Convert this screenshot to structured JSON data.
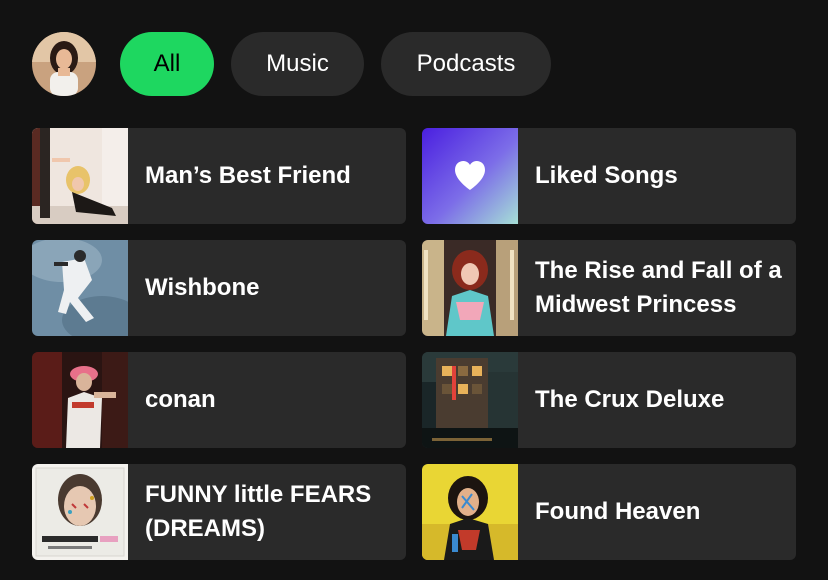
{
  "filters": {
    "all_label": "All",
    "music_label": "Music",
    "podcasts_label": "Podcasts",
    "active": "All"
  },
  "shortcuts": [
    {
      "title": "Man’s Best Friend",
      "cover_icon": "album-cover"
    },
    {
      "title": "Liked Songs",
      "cover_icon": "heart-icon"
    },
    {
      "title": "Wishbone",
      "cover_icon": "album-cover"
    },
    {
      "title": "The Rise and Fall of a Midwest Princess",
      "cover_icon": "album-cover"
    },
    {
      "title": "conan",
      "cover_icon": "album-cover"
    },
    {
      "title": "The Crux Deluxe",
      "cover_icon": "album-cover"
    },
    {
      "title": "FUNNY little FEARS (DREAMS)",
      "cover_icon": "album-cover"
    },
    {
      "title": "Found Heaven",
      "cover_icon": "album-cover"
    }
  ],
  "colors": {
    "background": "#121212",
    "tile": "#2a2a2a",
    "accent": "#1ed760",
    "liked_gradient_start": "#4a1fe0",
    "liked_gradient_end": "#a6e0d6"
  }
}
